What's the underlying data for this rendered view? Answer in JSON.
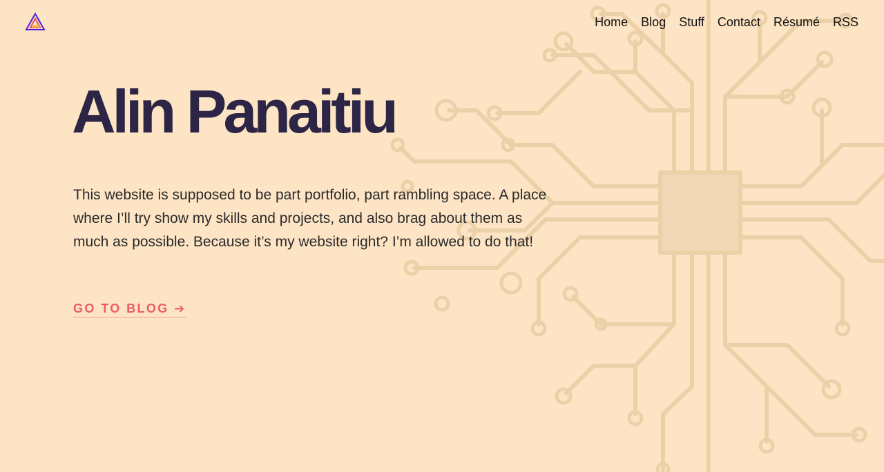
{
  "brand": {
    "logo_icon": "triangle-logo-icon"
  },
  "nav": {
    "items": [
      {
        "label": "Home"
      },
      {
        "label": "Blog"
      },
      {
        "label": "Stuff"
      },
      {
        "label": "Contact"
      },
      {
        "label": "Résumé"
      },
      {
        "label": "RSS"
      }
    ]
  },
  "hero": {
    "title": "Alin Panaitiu",
    "intro": "This website is supposed to be part portfolio, part rambling space. A place where I’ll try show my skills and projects, and also brag about them as much as possible. Because it’s my website right? I’m allowed to do that!",
    "cta_label": "GO TO BLOG ➔"
  },
  "colors": {
    "background": "#fde4c4",
    "title": "#2c2545",
    "cta": "#ec5a66",
    "circuit": "#eccfa6"
  }
}
